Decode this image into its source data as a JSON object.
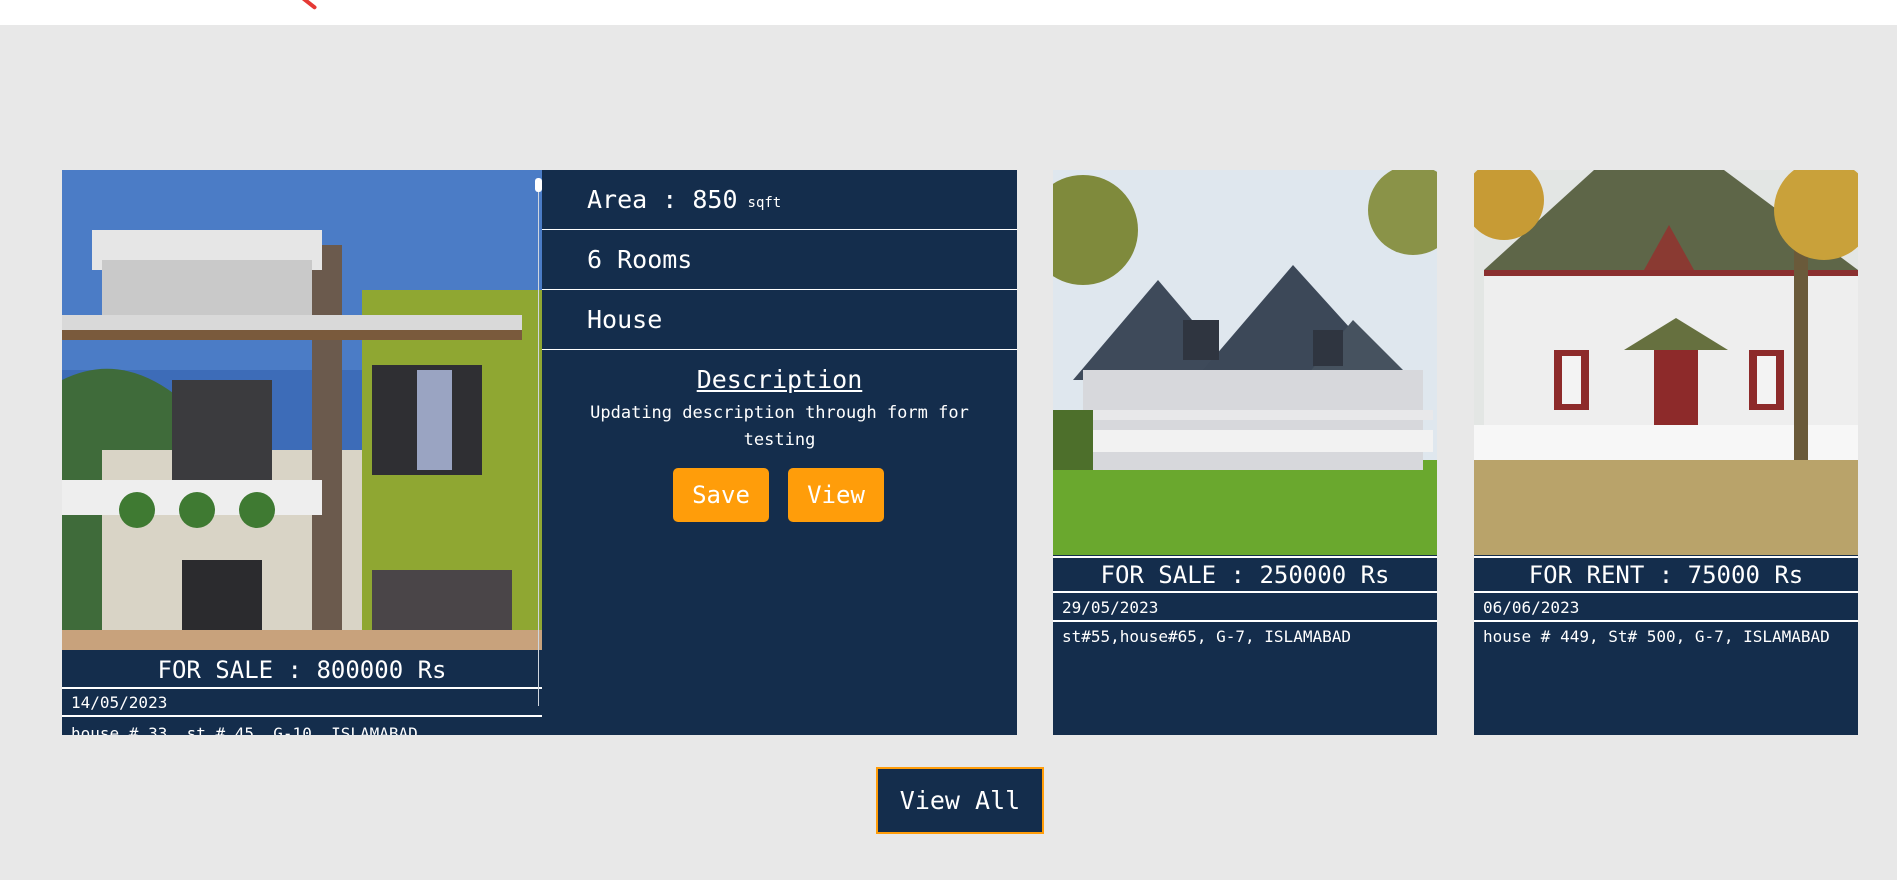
{
  "listings": [
    {
      "price": "FOR SALE : 800000 Rs",
      "date": "14/05/2023",
      "address": "house # 33, st # 45, G-10, ISLAMABAD",
      "details": {
        "area": "Area : 850",
        "area_unit": "sqft",
        "rooms": "6 Rooms",
        "type": "House",
        "description_title": "Description",
        "description": "Updating description through form for testing",
        "save_label": "Save",
        "view_label": "View"
      }
    },
    {
      "price": "FOR SALE : 250000 Rs",
      "date": "29/05/2023",
      "address": "st#55,house#65, G-7, ISLAMABAD"
    },
    {
      "price": "FOR RENT : 75000 Rs",
      "date": "06/06/2023",
      "address": "house # 449, St# 500, G-7, ISLAMABAD"
    }
  ],
  "view_all_label": "View All",
  "colors": {
    "card_bg": "#142d4c",
    "accent": "#ff9d0a",
    "page_bg": "#e8e8e8"
  }
}
